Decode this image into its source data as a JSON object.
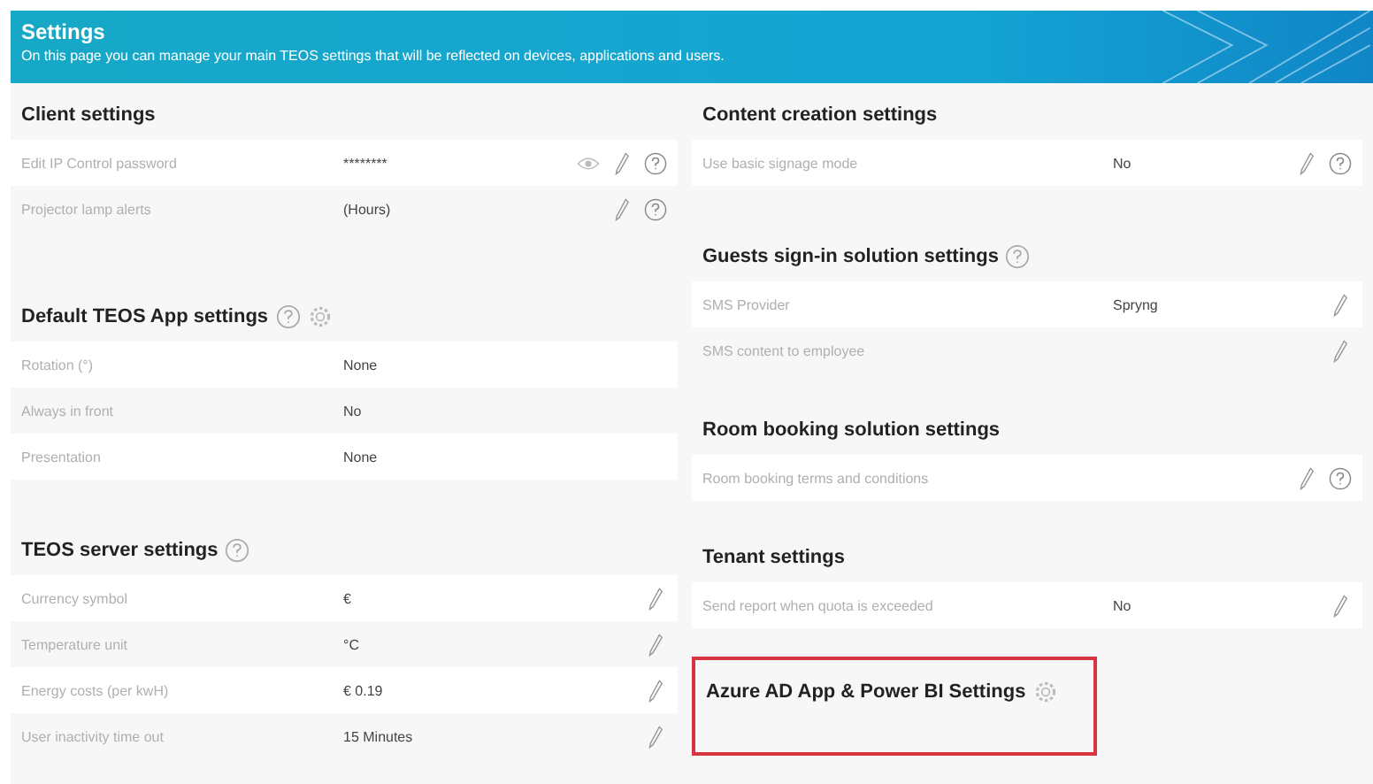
{
  "header": {
    "title": "Settings",
    "subtitle": "On this page you can manage your main TEOS settings that will be reflected on devices, applications and users."
  },
  "columns": [
    {
      "sections": [
        {
          "title": "Client settings",
          "rows": [
            {
              "label": "Edit IP Control password",
              "value": "********",
              "eye": true,
              "edit": true,
              "help": true
            },
            {
              "label": "Projector lamp alerts",
              "value": "(Hours)",
              "edit": true,
              "help": true
            }
          ]
        },
        {
          "title": "Default TEOS App settings",
          "help": true,
          "gear": true,
          "rows": [
            {
              "label": "Rotation (°)",
              "value": "None"
            },
            {
              "label": "Always in front",
              "value": "No"
            },
            {
              "label": "Presentation",
              "value": "None"
            }
          ]
        },
        {
          "title": "TEOS server settings",
          "help": true,
          "rows": [
            {
              "label": "Currency symbol",
              "value": "€",
              "edit": true
            },
            {
              "label": "Temperature unit",
              "value": "°C",
              "edit": true
            },
            {
              "label": "Energy costs (per kwH)",
              "value": "€ 0.19",
              "edit": true
            },
            {
              "label": "User inactivity time out",
              "value": "15 Minutes",
              "edit": true
            }
          ]
        }
      ]
    },
    {
      "sections": [
        {
          "title": "Content creation settings",
          "rows": [
            {
              "label": "Use basic signage mode",
              "value": "No",
              "edit": true,
              "help": true
            }
          ]
        },
        {
          "title": "Guests sign-in solution settings",
          "help": true,
          "rows": [
            {
              "label": "SMS Provider",
              "value": "Spryng",
              "edit": true
            },
            {
              "label": "SMS content to employee",
              "edit": true
            }
          ]
        },
        {
          "title": "Room booking solution settings",
          "rows": [
            {
              "label": "Room booking terms and conditions",
              "edit": true,
              "help": true
            }
          ]
        },
        {
          "title": "Tenant settings",
          "rows": [
            {
              "label": "Send report when quota is exceeded",
              "value": "No",
              "edit": true
            }
          ]
        },
        {
          "title": "Azure AD App & Power BI Settings",
          "gear": true,
          "highlighted": true
        }
      ]
    }
  ]
}
